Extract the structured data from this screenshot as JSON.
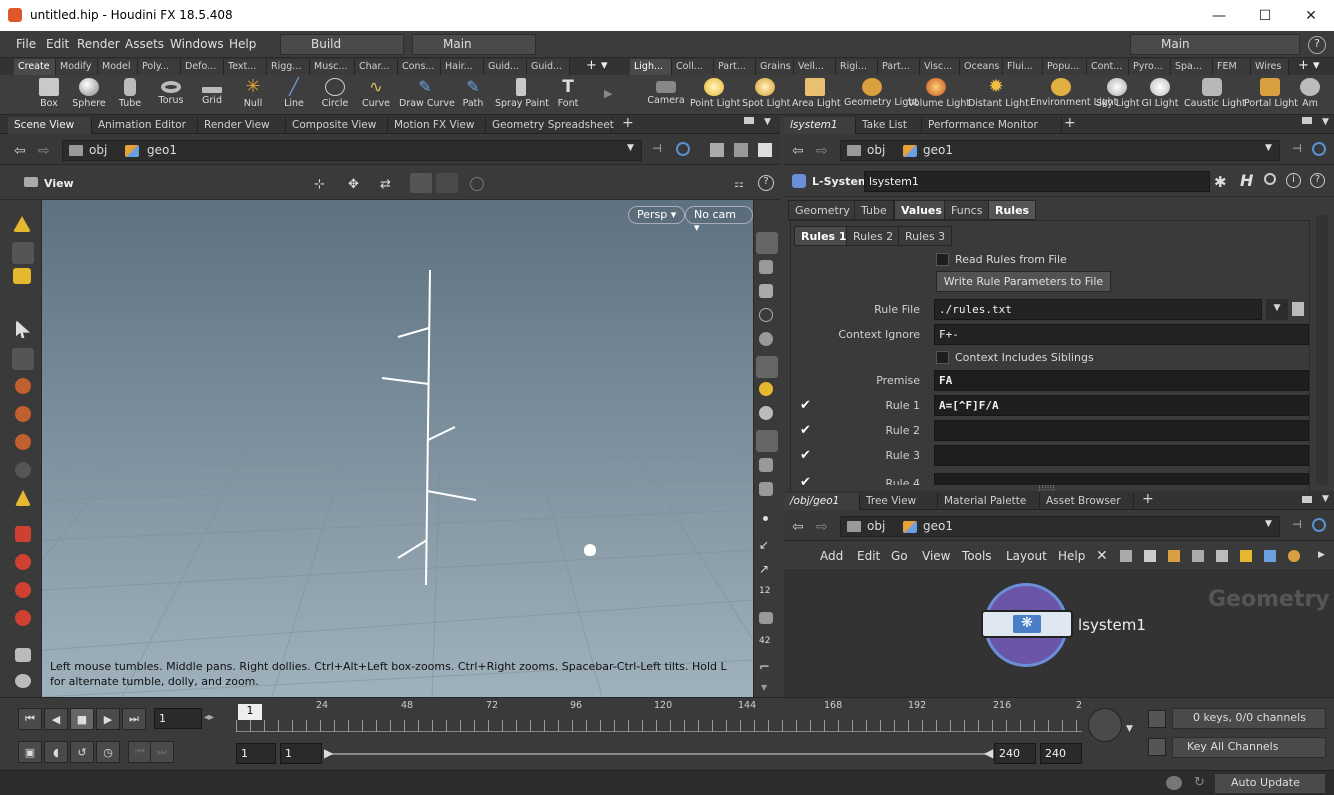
{
  "window": {
    "title": "untitled.hip - Houdini FX 18.5.408"
  },
  "menu": {
    "items": [
      "File",
      "Edit",
      "Render",
      "Assets",
      "Windows",
      "Help"
    ],
    "desktop_left": "Build",
    "desktop_mid": "Main",
    "desktop_right": "Main"
  },
  "shelf_tabs_left": [
    "Create",
    "Modify",
    "Model",
    "Poly...",
    "Defo...",
    "Text...",
    "Rigg...",
    "Musc...",
    "Char...",
    "Cons...",
    "Hair...",
    "Guid...",
    "Guid..."
  ],
  "shelf_tabs_right": [
    "Ligh...",
    "Coll...",
    "Part...",
    "Grains",
    "Vell...",
    "Rigi...",
    "Part...",
    "Visc...",
    "Oceans",
    "Flui...",
    "Popu...",
    "Cont...",
    "Pyro...",
    "Spa...",
    "FEM",
    "Wires"
  ],
  "shelf_tools_left": [
    "Box",
    "Sphere",
    "Tube",
    "Torus",
    "Grid",
    "Null",
    "Line",
    "Circle",
    "Curve",
    "Draw Curve",
    "Path",
    "Spray Paint",
    "Font"
  ],
  "shelf_tools_right": [
    "Camera",
    "Point Light",
    "Spot Light",
    "Area Light",
    "Geometry Light",
    "Volume Light",
    "Distant Light",
    "Environment Light",
    "Sky Light",
    "GI Light",
    "Caustic Light",
    "Portal Light",
    "Am"
  ],
  "left_pane": {
    "tabs": [
      "Scene View",
      "Animation Editor",
      "Render View",
      "Composite View",
      "Motion FX View",
      "Geometry Spreadsheet"
    ],
    "path": [
      "obj",
      "geo1"
    ],
    "view_label": "View",
    "persp": "Persp",
    "cam": "No cam",
    "help_text": "Left mouse tumbles. Middle pans. Right dollies. Ctrl+Alt+Left box-zooms. Ctrl+Right zooms. Spacebar-Ctrl-Left tilts. Hold L for alternate tumble, dolly, and zoom."
  },
  "right_top": {
    "tabs": [
      "lsystem1",
      "Take List",
      "Performance Monitor"
    ],
    "path": [
      "obj",
      "geo1"
    ],
    "node_type": "L-System",
    "node_name": "lsystem1",
    "parm_tabs": [
      "Geometry",
      "Tube",
      "Values",
      "Funcs",
      "Rules"
    ],
    "rule_tabs": [
      "Rules 1",
      "Rules 2",
      "Rules 3"
    ],
    "read_rules": "Read Rules from File",
    "write_rules": "Write Rule Parameters to File",
    "rule_file_label": "Rule File",
    "rule_file": "./rules.txt",
    "context_ignore_label": "Context Ignore",
    "context_ignore": "F+-",
    "context_siblings": "Context Includes Siblings",
    "premise_label": "Premise",
    "premise": "FA",
    "rules": [
      {
        "label": "Rule 1",
        "value": "A=[^F]F/A"
      },
      {
        "label": "Rule 2",
        "value": ""
      },
      {
        "label": "Rule 3",
        "value": ""
      },
      {
        "label": "Rule 4",
        "value": ""
      }
    ]
  },
  "right_bottom": {
    "tabs": [
      "/obj/geo1",
      "Tree View",
      "Material Palette",
      "Asset Browser"
    ],
    "path": [
      "obj",
      "geo1"
    ],
    "menu": [
      "Add",
      "Edit",
      "Go",
      "View",
      "Tools",
      "Layout",
      "Help"
    ],
    "context_label": "Geometry",
    "node_label": "lsystem1"
  },
  "timeline": {
    "frame": "1",
    "ticks": [
      "24",
      "48",
      "72",
      "96",
      "120",
      "144",
      "168",
      "192",
      "216",
      "2"
    ],
    "start": "1",
    "start2": "1",
    "end": "240",
    "end2": "240",
    "keys_info": "0 keys, 0/0 channels",
    "key_all": "Key All Channels",
    "current_marker": "1"
  },
  "status": {
    "auto_update": "Auto Update"
  },
  "colors": {
    "accent": "#e0572a",
    "node_ring": "#6a8fd8"
  }
}
